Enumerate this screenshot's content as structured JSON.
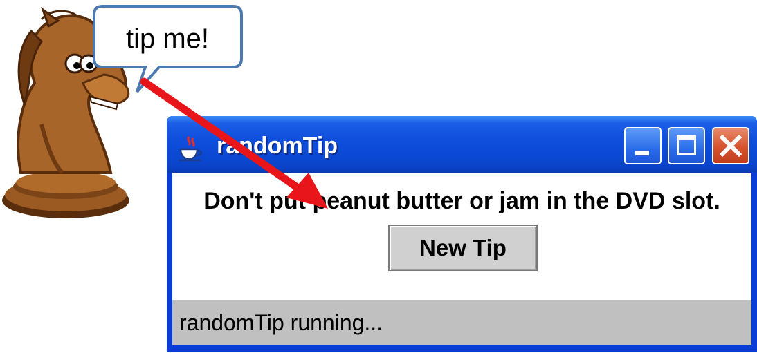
{
  "bubble": {
    "text": "tip me!"
  },
  "window": {
    "title": "randomTip",
    "icon": "java-coffee-cup-icon",
    "buttons": [
      "minimize",
      "maximize",
      "close"
    ]
  },
  "content": {
    "tip": "Don't put peanut butter or jam in the DVD slot.",
    "new_tip_label": "New Tip"
  },
  "status": {
    "text": "randomTip running..."
  },
  "colors": {
    "titlebar": "#0b49d4",
    "close": "#d6532e",
    "arrow": "#e8161b",
    "statusbar": "#c0c0c0"
  }
}
